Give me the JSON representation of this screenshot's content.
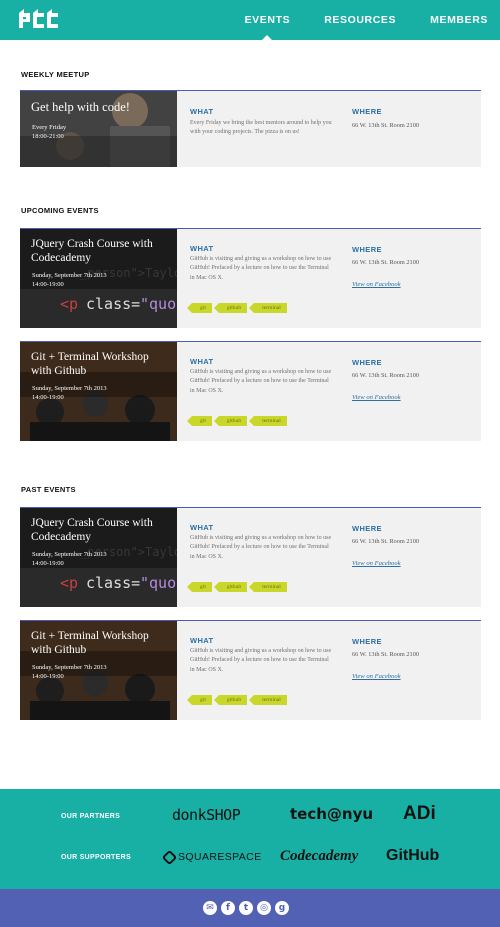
{
  "logo": "pcc",
  "nav": [
    {
      "label": "EVENTS",
      "active": true
    },
    {
      "label": "RESOURCES",
      "active": false
    },
    {
      "label": "MEMBERS",
      "active": false
    }
  ],
  "weekly": {
    "section_title": "WEEKLY MEETUP",
    "title": "Get help with code!",
    "date": "Every Friday",
    "time": "18:00-21:00",
    "what_heading": "WHAT",
    "what_text": "Every Friday we bring the best mentors around to help you with your coding projects. The pizza is on us!",
    "where_heading": "WHERE",
    "where_text": "66 W. 13th St. Room 2100"
  },
  "upcoming": {
    "section_title": "UPCOMING EVENTS",
    "events": [
      {
        "title": "JQuery Crash Course with Codecademy",
        "date": "Sunday, September 7th 2013",
        "time": "14:00-19:00",
        "what_heading": "WHAT",
        "what_text": "GitHub is visiting and giving us a workshop on how to use GitHub! Prefaced by a lecture on how to use the Terminal in Mac OS X.",
        "where_heading": "WHERE",
        "where_text": "66 W. 13th St. Room 2100",
        "link": "View on Facebook",
        "tags": [
          "git",
          "github",
          "terminal"
        ]
      },
      {
        "title": "Git + Terminal Workshop with Github",
        "date": "Sunday, September 7th 2013",
        "time": "14:00-19:00",
        "what_heading": "WHAT",
        "what_text": "GitHub is visiting and giving us a workshop on how to use GitHub! Prefaced by a lecture on how to use the Terminal in Mac OS X.",
        "where_heading": "WHERE",
        "where_text": "66 W. 13th St. Room 2100",
        "link": "View on Facebook",
        "tags": [
          "git",
          "github",
          "terminal"
        ]
      }
    ]
  },
  "past": {
    "section_title": "PAST EVENTS",
    "events": [
      {
        "title": "JQuery Crash Course with Codecademy",
        "date": "Sunday, September 7th 2013",
        "time": "14:00-19:00",
        "what_heading": "WHAT",
        "what_text": "GitHub is visiting and giving us a workshop on how to use GitHub! Prefaced by a lecture on how to use the Terminal in Mac OS X.",
        "where_heading": "WHERE",
        "where_text": "66 W. 13th St. Room 2100",
        "link": "View on Facebook",
        "tags": [
          "git",
          "github",
          "terminal"
        ]
      },
      {
        "title": "Git + Terminal Workshop with Github",
        "date": "Sunday, September 7th 2013",
        "time": "14:00-19:00",
        "what_heading": "WHAT",
        "what_text": "GitHub is visiting and giving us a workshop on how to use GitHub! Prefaced by a lecture on how to use the Terminal in Mac OS X.",
        "where_heading": "WHERE",
        "where_text": "66 W. 13th St. Room 2100",
        "link": "View on Facebook",
        "tags": [
          "git",
          "github",
          "terminal"
        ]
      }
    ]
  },
  "footer": {
    "partners_label": "OUR PARTNERS",
    "partners": [
      "donkSHOP",
      "tech@nyu",
      "ADi"
    ],
    "supporters_label": "OUR SUPPORTERS",
    "supporters": [
      "SQUARESPACE",
      "Codecademy",
      "GitHub"
    ],
    "social": [
      "email-icon",
      "facebook-icon",
      "twitter-icon",
      "instagram-icon",
      "google-icon"
    ]
  },
  "colors": {
    "teal": "#18b0a5",
    "indigo": "#5361b5",
    "heading_blue": "#2c6fa3",
    "tag_green": "#c9d72a"
  }
}
